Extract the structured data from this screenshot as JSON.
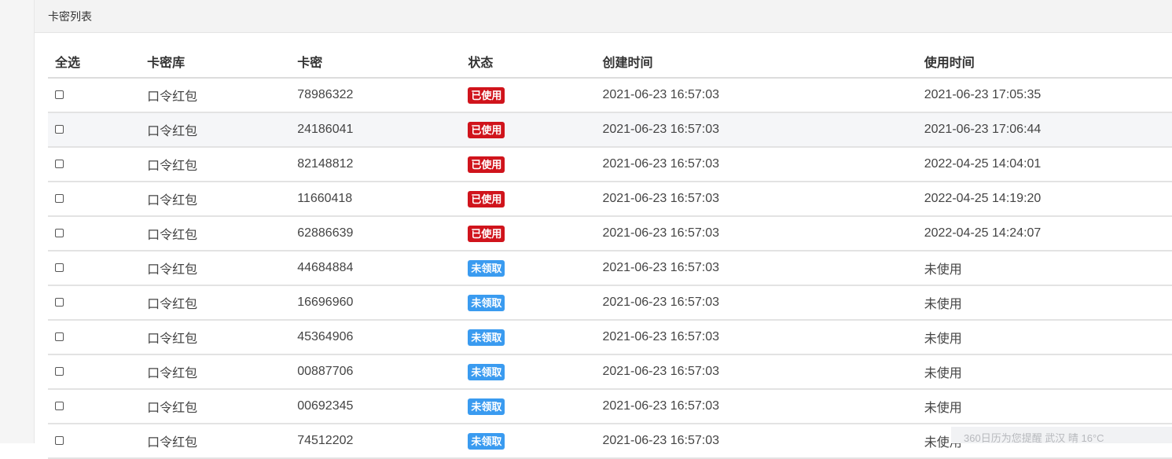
{
  "panel": {
    "title": "卡密列表"
  },
  "table": {
    "headers": {
      "select_all": "全选",
      "library": "卡密库",
      "card_key": "卡密",
      "status": "状态",
      "created": "创建时间",
      "used_at": "使用时间"
    },
    "rows": [
      {
        "library": "口令红包",
        "card_key": "78986322",
        "status": "已使用",
        "status_type": "used",
        "created": "2021-06-23 16:57:03",
        "used_at": "2021-06-23 17:05:35"
      },
      {
        "library": "口令红包",
        "card_key": "24186041",
        "status": "已使用",
        "status_type": "used",
        "created": "2021-06-23 16:57:03",
        "used_at": "2021-06-23 17:06:44"
      },
      {
        "library": "口令红包",
        "card_key": "82148812",
        "status": "已使用",
        "status_type": "used",
        "created": "2021-06-23 16:57:03",
        "used_at": "2022-04-25 14:04:01"
      },
      {
        "library": "口令红包",
        "card_key": "11660418",
        "status": "已使用",
        "status_type": "used",
        "created": "2021-06-23 16:57:03",
        "used_at": "2022-04-25 14:19:20"
      },
      {
        "library": "口令红包",
        "card_key": "62886639",
        "status": "已使用",
        "status_type": "used",
        "created": "2021-06-23 16:57:03",
        "used_at": "2022-04-25 14:24:07"
      },
      {
        "library": "口令红包",
        "card_key": "44684884",
        "status": "未领取",
        "status_type": "unused",
        "created": "2021-06-23 16:57:03",
        "used_at": "未使用"
      },
      {
        "library": "口令红包",
        "card_key": "16696960",
        "status": "未领取",
        "status_type": "unused",
        "created": "2021-06-23 16:57:03",
        "used_at": "未使用"
      },
      {
        "library": "口令红包",
        "card_key": "45364906",
        "status": "未领取",
        "status_type": "unused",
        "created": "2021-06-23 16:57:03",
        "used_at": "未使用"
      },
      {
        "library": "口令红包",
        "card_key": "00887706",
        "status": "未领取",
        "status_type": "unused",
        "created": "2021-06-23 16:57:03",
        "used_at": "未使用"
      },
      {
        "library": "口令红包",
        "card_key": "00692345",
        "status": "未领取",
        "status_type": "unused",
        "created": "2021-06-23 16:57:03",
        "used_at": "未使用"
      },
      {
        "library": "口令红包",
        "card_key": "74512202",
        "status": "未领取",
        "status_type": "unused",
        "created": "2021-06-23 16:57:03",
        "used_at": "未使用"
      }
    ]
  },
  "weather_tip": {
    "text": "360日历为您提醒 武汉 晴 16°C"
  },
  "colors": {
    "used_badge": "#d0141c",
    "unused_badge": "#3a9bf0"
  }
}
